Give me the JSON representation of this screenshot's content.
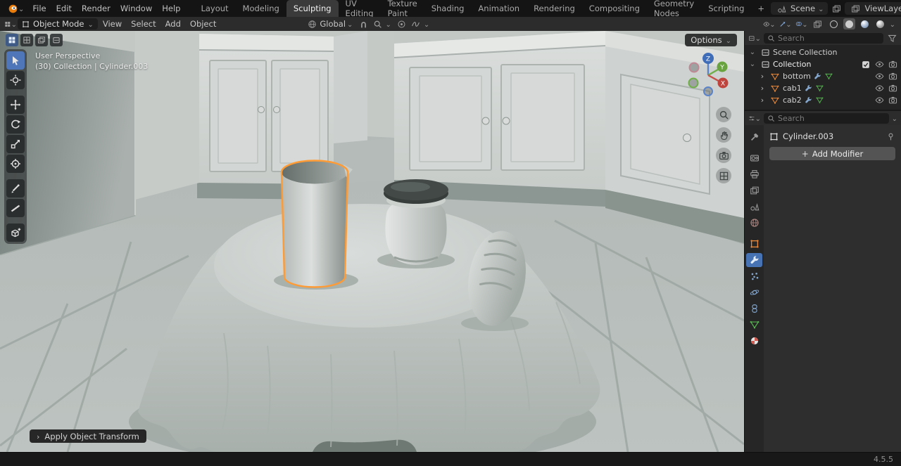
{
  "topbar": {
    "menus": [
      "File",
      "Edit",
      "Render",
      "Window",
      "Help"
    ],
    "workspaces": [
      "Layout",
      "Modeling",
      "Sculpting",
      "UV Editing",
      "Texture Paint",
      "Shading",
      "Animation",
      "Rendering",
      "Compositing",
      "Geometry Nodes",
      "Scripting"
    ],
    "active_workspace": "Sculpting",
    "add_tab": "+",
    "scene_label": "Scene",
    "viewlayer_label": "ViewLayer"
  },
  "header": {
    "mode": "Object Mode",
    "menus": [
      "View",
      "Select",
      "Add",
      "Object"
    ],
    "orientation": "Global",
    "options_label": "Options"
  },
  "viewport": {
    "perspective_label": "User Perspective",
    "context_label": "(30) Collection | Cylinder.003",
    "operator_label": "Apply Object Transform",
    "gizmo_axes": {
      "x": "X",
      "y": "Y",
      "z": "Z"
    }
  },
  "outliner": {
    "search_placeholder": "Search",
    "scene_collection_label": "Scene Collection",
    "collection_label": "Collection",
    "items": [
      {
        "name": "bottom"
      },
      {
        "name": "cab1"
      },
      {
        "name": "cab2"
      }
    ]
  },
  "properties": {
    "search_placeholder": "Search",
    "object_name": "Cylinder.003",
    "add_modifier_label": "Add Modifier"
  },
  "statusbar": {
    "version": "4.5.5"
  },
  "glyphs": {
    "caret_down": "⌄",
    "chevron_right": "›",
    "plus": "+"
  },
  "colors": {
    "accent": "#4772b3",
    "selection_outline": "#ff9b35",
    "mesh_icon": "#e8883a",
    "data_icon": "#55b24f"
  }
}
